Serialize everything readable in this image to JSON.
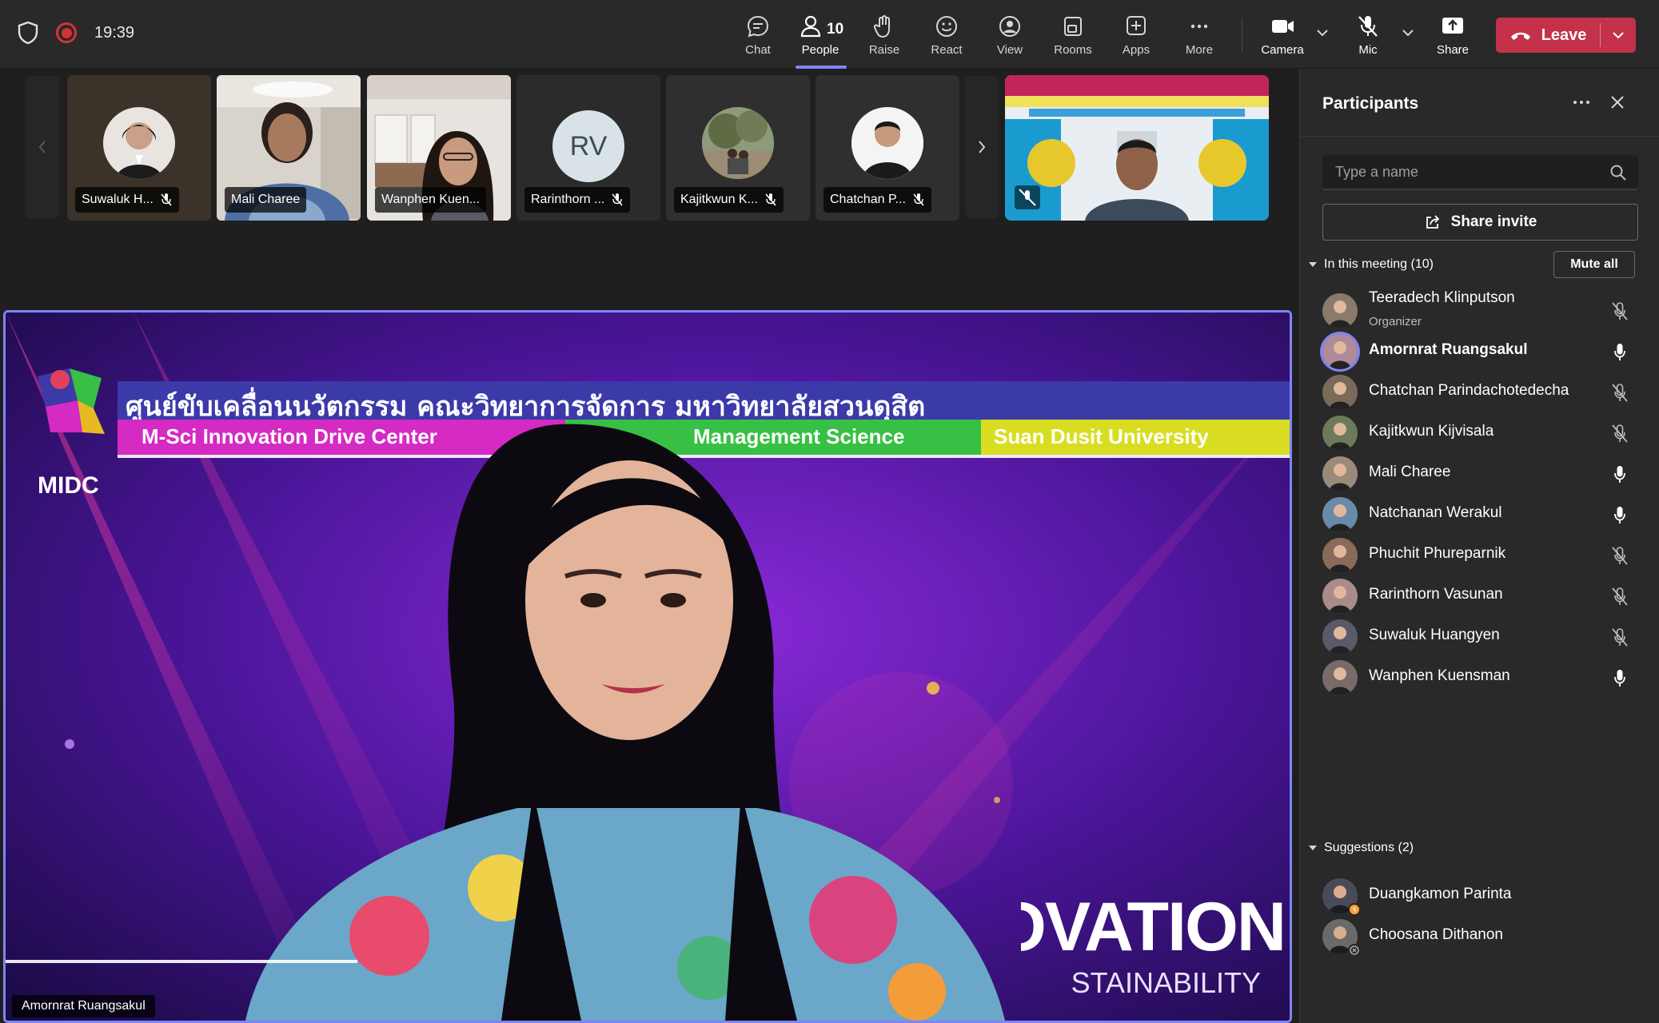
{
  "meeting": {
    "timer": "19:39",
    "people_count": "10"
  },
  "toolbar": {
    "chat": "Chat",
    "people": "People",
    "raise": "Raise",
    "react": "React",
    "view": "View",
    "rooms": "Rooms",
    "apps": "Apps",
    "more": "More",
    "camera": "Camera",
    "mic": "Mic",
    "share": "Share",
    "leave": "Leave"
  },
  "thumbnails": [
    {
      "name": "Suwaluk H...",
      "muted": true
    },
    {
      "name": "Mali Charee",
      "muted": false
    },
    {
      "name": "Wanphen Kuen...",
      "muted": false
    },
    {
      "name": "Rarinthorn ...",
      "initials": "RV",
      "muted": true
    },
    {
      "name": "Kajitkwun K...",
      "muted": true
    },
    {
      "name": "Chatchan P...",
      "muted": true
    }
  ],
  "main_video": {
    "speaker_name": "Amornrat Ruangsakul",
    "banner_thai": "ศูนย์ขับเคลื่อนนวัตกรรม คณะวิทยาการจัดการ มหาวิทยาลัยสวนดุสิต",
    "banner_center": "M-Sci Innovation Drive Center",
    "banner_science": "Management Science",
    "banner_university": "Suan Dusit University",
    "logo_text": "MIDC",
    "bg_word_1": "INNOVATION",
    "bg_word_2": "SUSTAINABILITY"
  },
  "panel": {
    "title": "Participants",
    "search_placeholder": "Type a name",
    "share_invite": "Share invite",
    "in_meeting_label": "In this meeting (10)",
    "mute_all": "Mute all",
    "suggestions_label": "Suggestions (2)",
    "participants": [
      {
        "name": "Teeradech Klinputson",
        "role": "Organizer",
        "mic": "off"
      },
      {
        "name": "Amornrat Ruangsakul",
        "mic": "on",
        "speaking": true
      },
      {
        "name": "Chatchan Parindachotedecha",
        "mic": "off"
      },
      {
        "name": "Kajitkwun Kijvisala",
        "mic": "off"
      },
      {
        "name": "Mali Charee",
        "mic": "on"
      },
      {
        "name": "Natchanan Werakul",
        "mic": "on"
      },
      {
        "name": "Phuchit Phureparnik",
        "mic": "off"
      },
      {
        "name": "Rarinthorn Vasunan",
        "mic": "off"
      },
      {
        "name": "Suwaluk Huangyen",
        "mic": "off"
      },
      {
        "name": "Wanphen Kuensman",
        "mic": "on"
      }
    ],
    "suggestions": [
      {
        "name": "Duangkamon Parinta"
      },
      {
        "name": "Choosana Dithanon"
      }
    ]
  },
  "colors": {
    "accent": "#7f85f5",
    "leave": "#c4314b",
    "record": "#d13438"
  }
}
